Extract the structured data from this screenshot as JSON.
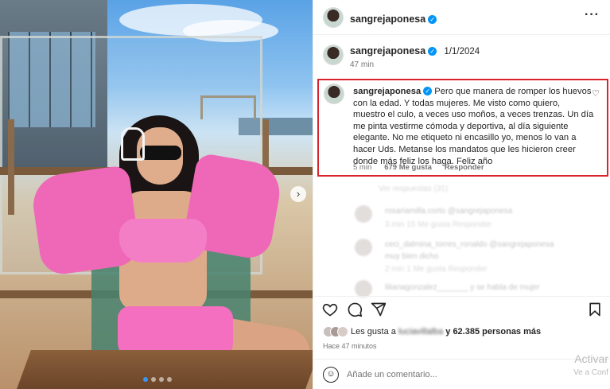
{
  "post": {
    "author": "sangrejaponesa",
    "slide_count": 4,
    "active_slide": 1
  },
  "subheader": {
    "author": "sangrejaponesa",
    "date": "1/1/2024",
    "age": "47 min"
  },
  "caption": {
    "author": "sangrejaponesa",
    "text": "Pero que manera de romper los huevos con la edad. Y todas mujeres. Me visto como quiero, muestro el culo, a veces uso moños, a veces trenzas. Un día me pinta vestirme cómoda y deportiva, al día siguiente elegante. No me etiqueto ni encasillo yo, menos lo van a hacer Uds. Metanse los mandatos que les hicieron creer donde más feliz los haga. Feliz año",
    "age": "5 min",
    "likes": "679 Me gusta",
    "reply": "Responder"
  },
  "faded_comments": {
    "see_replies": "Ver respuestas (31)",
    "row1": "rosariamilla.corto @sangrejaponesa",
    "row1_meta": "3 min   15 Me gusta   Responder",
    "row2": "ceci_dalmina_torres_ronaldo @sangrejaponesa",
    "row2_text": "muy bien dicho",
    "row2_meta": "2 min   1 Me gusta   Responder",
    "row3": "lilianagonzalez_______ y se habla de mujer"
  },
  "likes_line": {
    "prefix": "Les gusta a",
    "user": "luciavillalba",
    "suffix": "y 62.385 personas más"
  },
  "posted_ago": "Hace 47 minutos",
  "comment_input": {
    "placeholder": "Añade un comentario..."
  },
  "watermark": {
    "line1": "Activar",
    "line2": "Ve a Conf"
  },
  "icons": [
    "verified-badge-icon",
    "more-options-icon",
    "heart-icon",
    "comment-icon",
    "share-icon",
    "save-icon",
    "emoji-icon",
    "chevron-right-icon"
  ],
  "colors": {
    "accent_blue": "#0095f6",
    "highlight_red": "#d9232e"
  }
}
